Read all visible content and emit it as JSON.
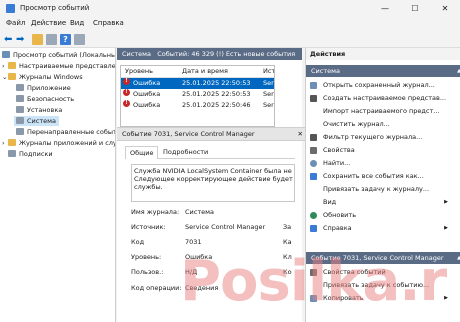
{
  "window": {
    "title": "Просмотр событий",
    "minimize": "—",
    "maximize": "☐",
    "close": "✕"
  },
  "menu": [
    "Файл",
    "Действие",
    "Вид",
    "Справка"
  ],
  "tree": [
    {
      "label": "Просмотр событий (Локальный)",
      "indent": 0,
      "icon": "event-viewer-icon",
      "expander": ""
    },
    {
      "label": "Настраиваемые представления",
      "indent": 1,
      "icon": "folder-icon",
      "expander": "›"
    },
    {
      "label": "Журналы Windows",
      "indent": 1,
      "icon": "folder-icon",
      "expander": "⌄"
    },
    {
      "label": "Приложение",
      "indent": 2,
      "icon": "log-icon",
      "expander": ""
    },
    {
      "label": "Безопасность",
      "indent": 2,
      "icon": "log-icon",
      "expander": ""
    },
    {
      "label": "Установка",
      "indent": 2,
      "icon": "log-icon",
      "expander": ""
    },
    {
      "label": "Система",
      "indent": 2,
      "icon": "log-icon",
      "expander": "",
      "selected": true
    },
    {
      "label": "Перенаправленные события",
      "indent": 2,
      "icon": "log-icon",
      "expander": ""
    },
    {
      "label": "Журналы приложений и служб",
      "indent": 1,
      "icon": "folder-icon",
      "expander": "›"
    },
    {
      "label": "Подписки",
      "indent": 1,
      "icon": "subscription-icon",
      "expander": ""
    }
  ],
  "log_header": {
    "name": "Система",
    "info": "Событий: 46 329 (!) Есть новые события"
  },
  "grid_columns": [
    "Уровень",
    "Дата и время",
    "Источ"
  ],
  "events": [
    {
      "level": "Ошибка",
      "datetime": "25.01.2025 22:50:53",
      "source": "Service",
      "selected": true
    },
    {
      "level": "Ошибка",
      "datetime": "25.01.2025 22:50:53",
      "source": "Service"
    },
    {
      "level": "Ошибка",
      "datetime": "25.01.2025 22:50:46",
      "source": "Service"
    }
  ],
  "details": {
    "header": "Событие 7031, Service Control Manager",
    "close": "✕",
    "tabs": [
      "Общие",
      "Подробности"
    ],
    "message_lines": [
      "Служба NVIDIA LocalSystem Container была не",
      "Следующее корректирующее действие будет",
      "службы."
    ],
    "fields": [
      {
        "label": "Имя журнала:",
        "value": "Система",
        "extra": ""
      },
      {
        "label": "Источник:",
        "value": "Service Control Manager",
        "extra": "За"
      },
      {
        "label": "Код",
        "value": "7031",
        "extra": "Ка"
      },
      {
        "label": "Уровень:",
        "value": "Ошибка",
        "extra": "Кл"
      },
      {
        "label": "Пользов.:",
        "value": "Н/Д",
        "extra": "Ко"
      },
      {
        "label": "Код операции:",
        "value": "Сведения",
        "extra": ""
      }
    ]
  },
  "actions_title": "Действия",
  "actions_section1": "Система",
  "actions": [
    {
      "label": "Открыть сохраненный журнал...",
      "icon": "open-log-icon",
      "color": "#6b8fb5",
      "arrow": ""
    },
    {
      "label": "Создать настраиваемое представ...",
      "icon": "filter-icon",
      "color": "#555555",
      "arrow": ""
    },
    {
      "label": "Импорт настраиваемого предст...",
      "icon": "import-icon",
      "color": "#cccccc",
      "arrow": ""
    },
    {
      "label": "Очистить журнал...",
      "icon": "clear-icon",
      "color": "#cccccc",
      "arrow": ""
    },
    {
      "label": "Фильтр текущего журнала...",
      "icon": "filter-icon",
      "color": "#555555",
      "arrow": ""
    },
    {
      "label": "Свойства",
      "icon": "properties-icon",
      "color": "#6b6b6b",
      "arrow": ""
    },
    {
      "label": "Найти...",
      "icon": "find-icon",
      "color": "#6b8fb5",
      "arrow": ""
    },
    {
      "label": "Сохранить все события как...",
      "icon": "save-icon",
      "color": "#3a7bd5",
      "arrow": ""
    },
    {
      "label": "Привязать задачу к журналу...",
      "icon": "task-icon",
      "color": "#cccccc",
      "arrow": ""
    },
    {
      "label": "Вид",
      "icon": "view-icon",
      "color": "#ffffff",
      "arrow": "▶"
    },
    {
      "label": "Обновить",
      "icon": "refresh-icon",
      "color": "#2e8b57",
      "arrow": ""
    },
    {
      "label": "Справка",
      "icon": "help-icon",
      "color": "#3a7bd5",
      "arrow": "▶"
    }
  ],
  "actions_section2": "Событие 7031, Service Control Manager",
  "actions2": [
    {
      "label": "Свойства событий",
      "icon": "properties-icon",
      "color": "#6b6b6b",
      "arrow": ""
    },
    {
      "label": "Привязать задачу к событию...",
      "icon": "task-icon",
      "color": "#cccccc",
      "arrow": ""
    },
    {
      "label": "Копировать",
      "icon": "copy-icon",
      "color": "#6b8fb5",
      "arrow": "▶"
    }
  ],
  "watermark": "Posilka.ru",
  "colors": {
    "accent": "#0067c0",
    "header_dark": "#5a6b86",
    "selection": "#cce4f7",
    "error": "#c62828"
  }
}
